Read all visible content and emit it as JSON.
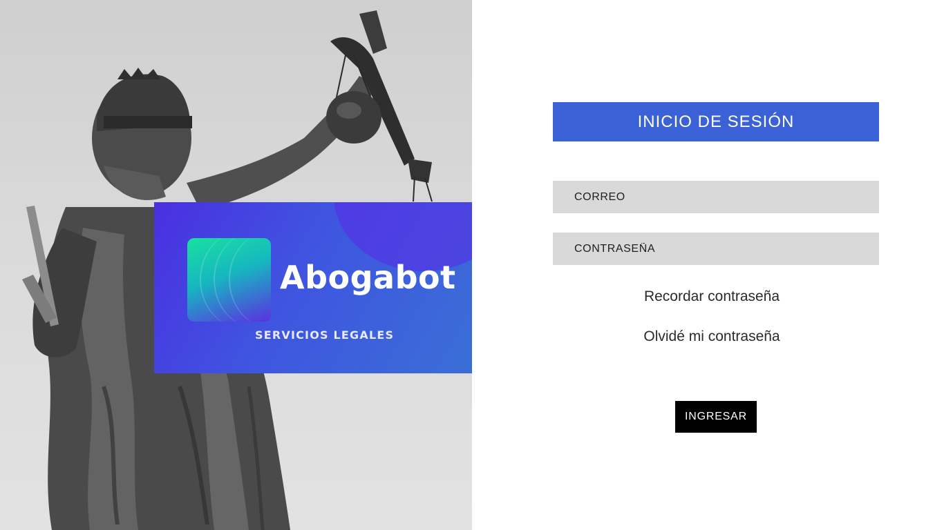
{
  "brand": {
    "name": "Abogabot",
    "tagline": "SERVICIOS LEGALES"
  },
  "login": {
    "title": "INICIO DE SESIÓN",
    "email_placeholder": "CORREO",
    "password_placeholder": "CONTRASEÑA",
    "remember_label": "Recordar contraseña",
    "forgot_label": "Olvidé mi contraseña",
    "submit_label": "INGRESAR"
  },
  "colors": {
    "header_blue": "#3b61d6",
    "field_gray": "#d9d9d9",
    "button_black": "#000000",
    "brand_gradient_start": "#4a2fe0",
    "brand_gradient_end": "#3a6fd6",
    "logo_green": "#19e0a0"
  },
  "icons": {
    "hero_image": "lady-justice-statue",
    "brand_logo": "abogabot-logo-icon"
  }
}
